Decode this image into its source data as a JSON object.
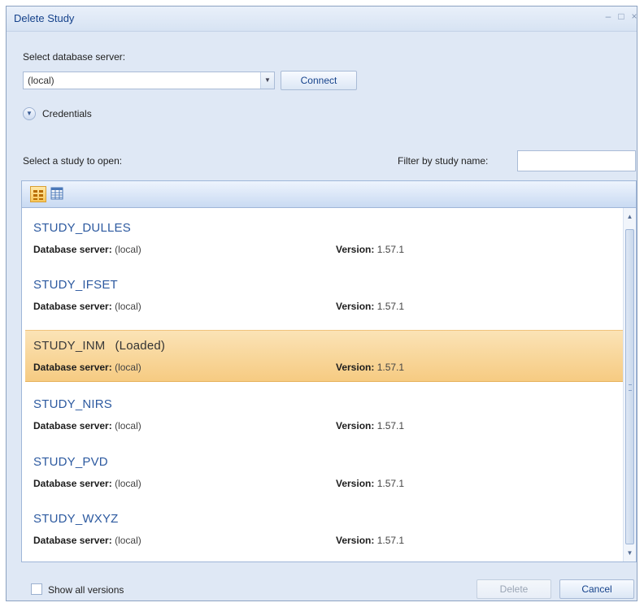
{
  "window": {
    "title": "Delete Study",
    "minimize": "–",
    "maximize": "□",
    "close": "×"
  },
  "server": {
    "label": "Select database server:",
    "value": "(local)",
    "connect_label": "Connect",
    "credentials_label": "Credentials"
  },
  "study_list": {
    "label": "Select a study to open:",
    "filter_label": "Filter by study name:",
    "filter_value": "",
    "items": [
      {
        "name": "STUDY_DULLES",
        "status": "",
        "server_label": "Database server:",
        "server": "(local)",
        "version_label": "Version:",
        "version": "1.57.1"
      },
      {
        "name": "STUDY_IFSET",
        "status": "",
        "server_label": "Database server:",
        "server": "(local)",
        "version_label": "Version:",
        "version": "1.57.1"
      },
      {
        "name": "STUDY_INM",
        "status": "(Loaded)",
        "server_label": "Database server:",
        "server": "(local)",
        "version_label": "Version:",
        "version": "1.57.1"
      },
      {
        "name": "STUDY_NIRS",
        "status": "",
        "server_label": "Database server:",
        "server": "(local)",
        "version_label": "Version:",
        "version": "1.57.1"
      },
      {
        "name": "STUDY_PVD",
        "status": "",
        "server_label": "Database server:",
        "server": "(local)",
        "version_label": "Version:",
        "version": "1.57.1"
      },
      {
        "name": "STUDY_WXYZ",
        "status": "",
        "server_label": "Database server:",
        "server": "(local)",
        "version_label": "Version:",
        "version": "1.57.1"
      }
    ],
    "selected_index": 2
  },
  "footer": {
    "show_all_label": "Show all versions",
    "delete_label": "Delete",
    "cancel_label": "Cancel"
  },
  "icons": {
    "view_list": "list-view-icon",
    "view_grid": "grid-view-icon",
    "credentials": "chevron-down-circle-icon"
  },
  "colors": {
    "selection": "#f6cb82",
    "link": "#2d5aa0",
    "title": "#15428b"
  }
}
